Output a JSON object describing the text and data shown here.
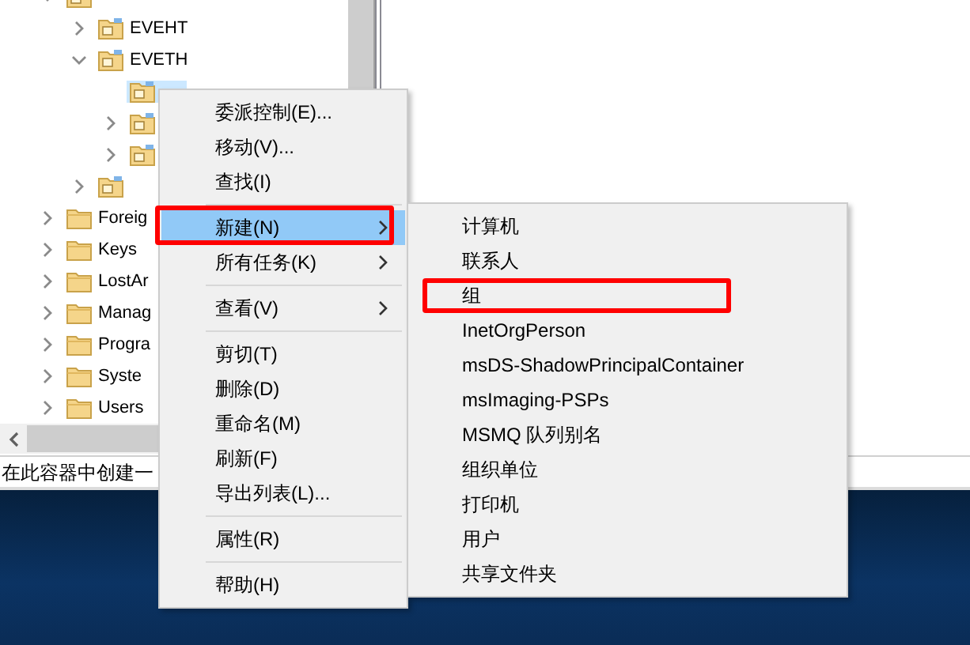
{
  "tree": [
    {
      "kind": "ou",
      "expanded": true,
      "selected": false,
      "children": [
        {
          "label": "EVEHT",
          "kind": "ou",
          "expanded": false,
          "selected": false
        },
        {
          "label": "EVETH",
          "kind": "ou",
          "expanded": true,
          "selected": false,
          "children": [
            {
              "kind": "ou",
              "selected": true
            },
            {
              "kind": "ou",
              "expanded": false,
              "selected": false
            },
            {
              "kind": "ou",
              "expanded": false,
              "selected": false
            }
          ]
        },
        {
          "kind": "ou",
          "expanded": false,
          "selected": false
        }
      ]
    },
    {
      "label": "Foreig",
      "kind": "container",
      "expanded": false,
      "selected": false
    },
    {
      "label": "Keys",
      "kind": "container",
      "expanded": false,
      "selected": false
    },
    {
      "label": "LostAr",
      "kind": "container",
      "expanded": false,
      "selected": false
    },
    {
      "label": "Manag",
      "kind": "container",
      "expanded": false,
      "selected": false
    },
    {
      "label": "Progra",
      "kind": "container",
      "expanded": false,
      "selected": false
    },
    {
      "label": "Syste",
      "kind": "container",
      "expanded": false,
      "selected": false
    },
    {
      "label": "Users",
      "kind": "container",
      "expanded": false,
      "selected": false
    }
  ],
  "status_bar": "在此容器中创建一",
  "context_menu": {
    "items": [
      {
        "kind": "item",
        "label": "委派控制(E)...",
        "selected": false
      },
      {
        "kind": "item",
        "label": "移动(V)...",
        "selected": false
      },
      {
        "kind": "item",
        "label": "查找(I)",
        "selected": false
      },
      {
        "kind": "separator"
      },
      {
        "kind": "item",
        "label": "新建(N)",
        "selected": true,
        "submenu": true,
        "annotated": true
      },
      {
        "kind": "item",
        "label": "所有任务(K)",
        "selected": false,
        "submenu": true
      },
      {
        "kind": "separator"
      },
      {
        "kind": "item",
        "label": "查看(V)",
        "selected": false,
        "submenu": true
      },
      {
        "kind": "separator"
      },
      {
        "kind": "item",
        "label": "剪切(T)",
        "selected": false
      },
      {
        "kind": "item",
        "label": "删除(D)",
        "selected": false
      },
      {
        "kind": "item",
        "label": "重命名(M)",
        "selected": false
      },
      {
        "kind": "item",
        "label": "刷新(F)",
        "selected": false
      },
      {
        "kind": "item",
        "label": "导出列表(L)...",
        "selected": false
      },
      {
        "kind": "separator"
      },
      {
        "kind": "item",
        "label": "属性(R)",
        "selected": false
      },
      {
        "kind": "separator"
      },
      {
        "kind": "item",
        "label": "帮助(H)",
        "selected": false
      }
    ]
  },
  "submenu": {
    "items": [
      {
        "kind": "item",
        "label": "计算机",
        "selected": false
      },
      {
        "kind": "item",
        "label": "联系人",
        "selected": false
      },
      {
        "kind": "item",
        "label": "组",
        "selected": false,
        "annotated": true
      },
      {
        "kind": "item",
        "label": "InetOrgPerson",
        "selected": false
      },
      {
        "kind": "item",
        "label": "msDS-ShadowPrincipalContainer",
        "selected": false
      },
      {
        "kind": "item",
        "label": "msImaging-PSPs",
        "selected": false
      },
      {
        "kind": "item",
        "label": "MSMQ 队列别名",
        "selected": false
      },
      {
        "kind": "item",
        "label": "组织单位",
        "selected": false
      },
      {
        "kind": "item",
        "label": "打印机",
        "selected": false
      },
      {
        "kind": "item",
        "label": "用户",
        "selected": false
      },
      {
        "kind": "item",
        "label": "共享文件夹",
        "selected": false
      }
    ]
  }
}
